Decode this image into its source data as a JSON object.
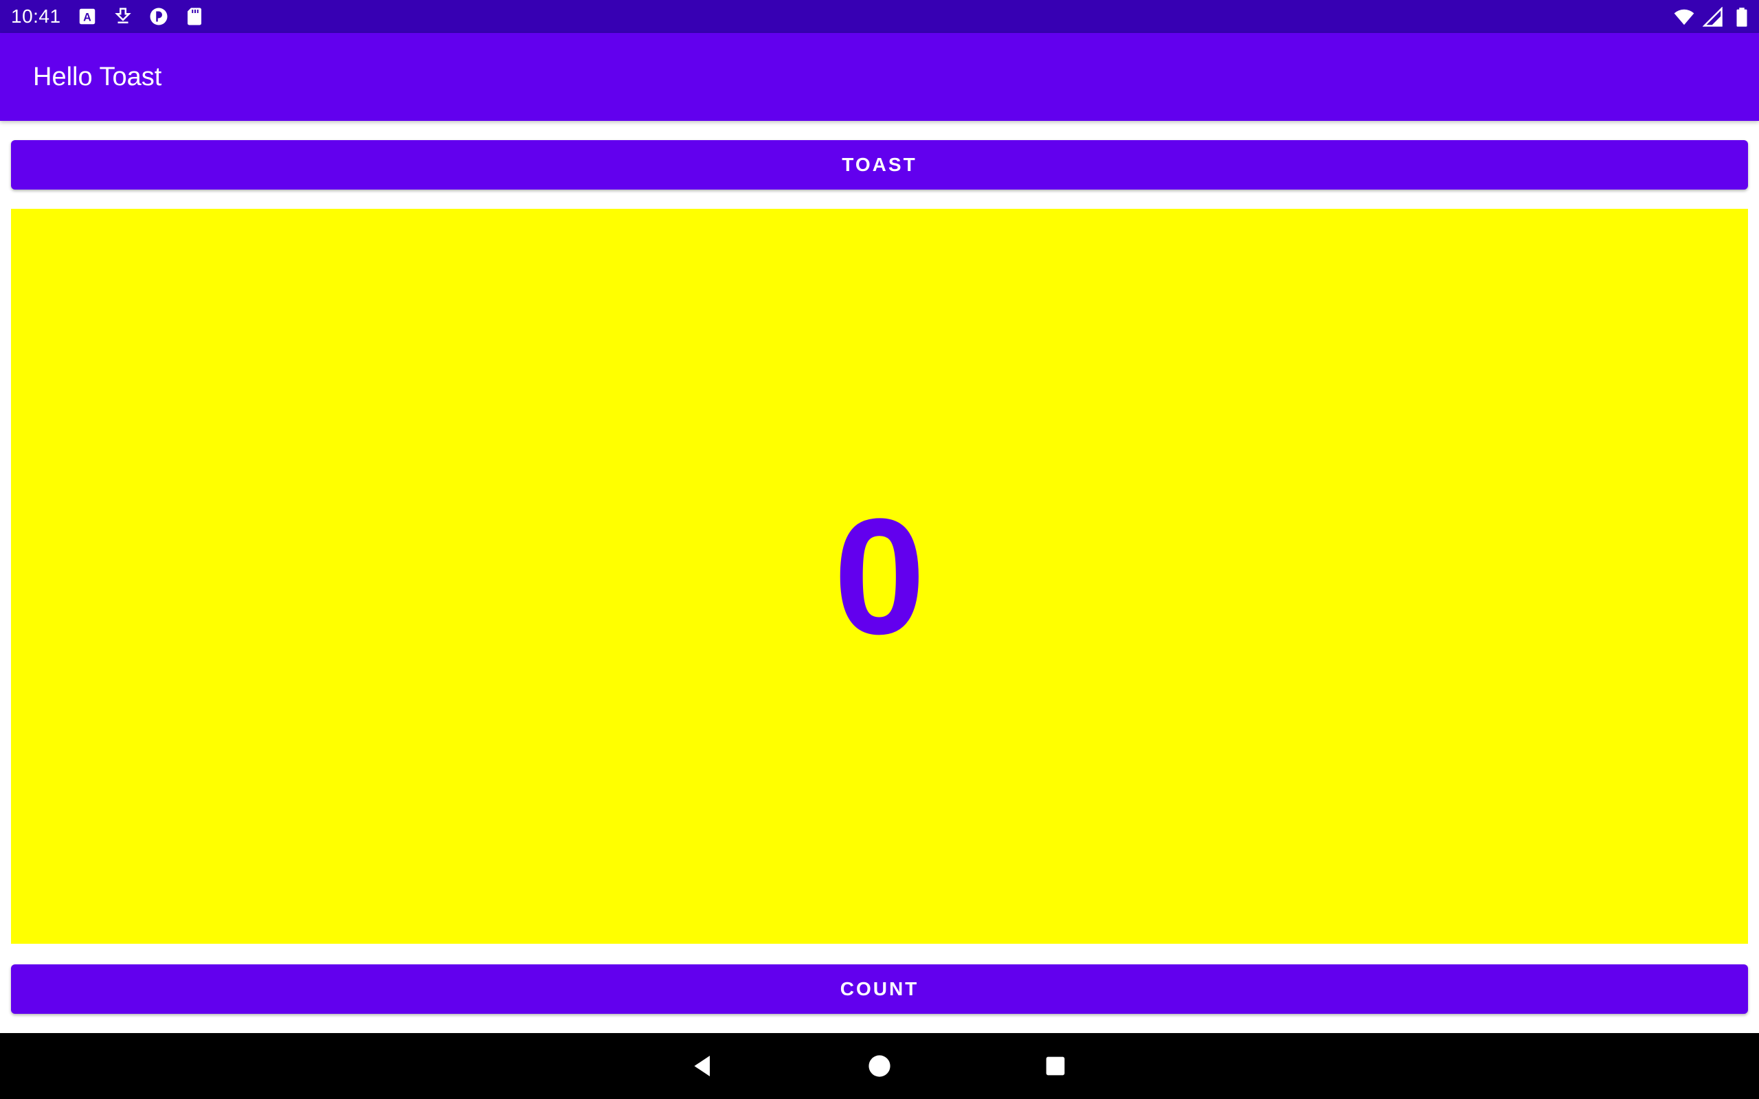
{
  "status_bar": {
    "time": "10:41",
    "left_icons": [
      "font-icon",
      "download-icon",
      "app-icon",
      "sd-card-icon"
    ],
    "right_icons": [
      "wifi-icon",
      "signal-icon",
      "battery-icon"
    ]
  },
  "app_bar": {
    "title": "Hello Toast"
  },
  "buttons": {
    "toast_label": "TOAST",
    "count_label": "COUNT"
  },
  "counter": {
    "value": "0"
  },
  "colors": {
    "status_bar": "#3700b3",
    "primary": "#6200ee",
    "panel": "#ffff00",
    "nav_bar": "#000000"
  },
  "nav_bar": {
    "buttons": [
      "back-icon",
      "home-icon",
      "recents-icon"
    ]
  }
}
